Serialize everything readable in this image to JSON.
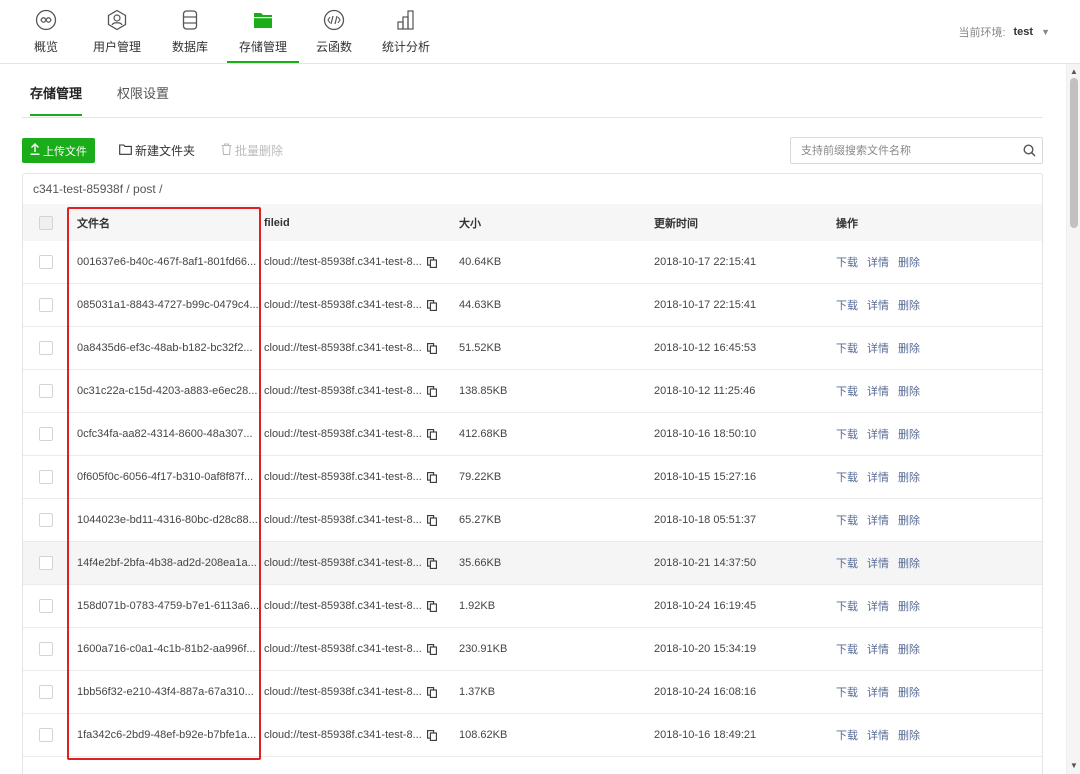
{
  "nav": {
    "items": [
      {
        "label": "概览",
        "icon": "overview-icon"
      },
      {
        "label": "用户管理",
        "icon": "user-icon"
      },
      {
        "label": "数据库",
        "icon": "database-icon"
      },
      {
        "label": "存储管理",
        "icon": "storage-folder-icon",
        "active": true
      },
      {
        "label": "云函数",
        "icon": "cloud-function-icon"
      },
      {
        "label": "统计分析",
        "icon": "statistics-icon"
      }
    ],
    "accent_color": "#1aad19"
  },
  "env": {
    "label": "当前环境:",
    "value": "test"
  },
  "subtabs": [
    {
      "label": "存储管理",
      "active": true
    },
    {
      "label": "权限设置"
    }
  ],
  "toolbar": {
    "upload_label": "上传文件",
    "new_folder_label": "新建文件夹",
    "batch_delete_label": "批量删除"
  },
  "search": {
    "placeholder": "支持前缀搜索文件名称"
  },
  "breadcrumb": "c341-test-85938f  /  post  /",
  "table": {
    "headers": {
      "name": "文件名",
      "fileid": "fileid",
      "size": "大小",
      "time": "更新时间",
      "ops": "操作"
    },
    "ops": {
      "download": "下载",
      "detail": "详情",
      "delete": "删除"
    },
    "rows": [
      {
        "name": "001637e6-b40c-467f-8af1-801fd66...",
        "fileid": "cloud://test-85938f.c341-test-8...",
        "size": "40.64KB",
        "time": "2018-10-17 22:15:41"
      },
      {
        "name": "085031a1-8843-4727-b99c-0479c4...",
        "fileid": "cloud://test-85938f.c341-test-8...",
        "size": "44.63KB",
        "time": "2018-10-17 22:15:41"
      },
      {
        "name": "0a8435d6-ef3c-48ab-b182-bc32f2...",
        "fileid": "cloud://test-85938f.c341-test-8...",
        "size": "51.52KB",
        "time": "2018-10-12 16:45:53"
      },
      {
        "name": "0c31c22a-c15d-4203-a883-e6ec28...",
        "fileid": "cloud://test-85938f.c341-test-8...",
        "size": "138.85KB",
        "time": "2018-10-12 11:25:46"
      },
      {
        "name": "0cfc34fa-aa82-4314-8600-48a307...",
        "fileid": "cloud://test-85938f.c341-test-8...",
        "size": "412.68KB",
        "time": "2018-10-16 18:50:10"
      },
      {
        "name": "0f605f0c-6056-4f17-b310-0af8f87f...",
        "fileid": "cloud://test-85938f.c341-test-8...",
        "size": "79.22KB",
        "time": "2018-10-15 15:27:16"
      },
      {
        "name": "1044023e-bd11-4316-80bc-d28c88...",
        "fileid": "cloud://test-85938f.c341-test-8...",
        "size": "65.27KB",
        "time": "2018-10-18 05:51:37"
      },
      {
        "name": "14f4e2bf-2bfa-4b38-ad2d-208ea1a...",
        "fileid": "cloud://test-85938f.c341-test-8...",
        "size": "35.66KB",
        "time": "2018-10-21 14:37:50",
        "hover": true
      },
      {
        "name": "158d071b-0783-4759-b7e1-6113a6...",
        "fileid": "cloud://test-85938f.c341-test-8...",
        "size": "1.92KB",
        "time": "2018-10-24 16:19:45"
      },
      {
        "name": "1600a716-c0a1-4c1b-81b2-aa996f...",
        "fileid": "cloud://test-85938f.c341-test-8...",
        "size": "230.91KB",
        "time": "2018-10-20 15:34:19"
      },
      {
        "name": "1bb56f32-e210-43f4-887a-67a310...",
        "fileid": "cloud://test-85938f.c341-test-8...",
        "size": "1.37KB",
        "time": "2018-10-24 16:08:16"
      },
      {
        "name": "1fa342c6-2bd9-48ef-b92e-b7bfe1a...",
        "fileid": "cloud://test-85938f.c341-test-8...",
        "size": "108.62KB",
        "time": "2018-10-16 18:49:21"
      }
    ]
  },
  "highlight_color": "#e02020"
}
